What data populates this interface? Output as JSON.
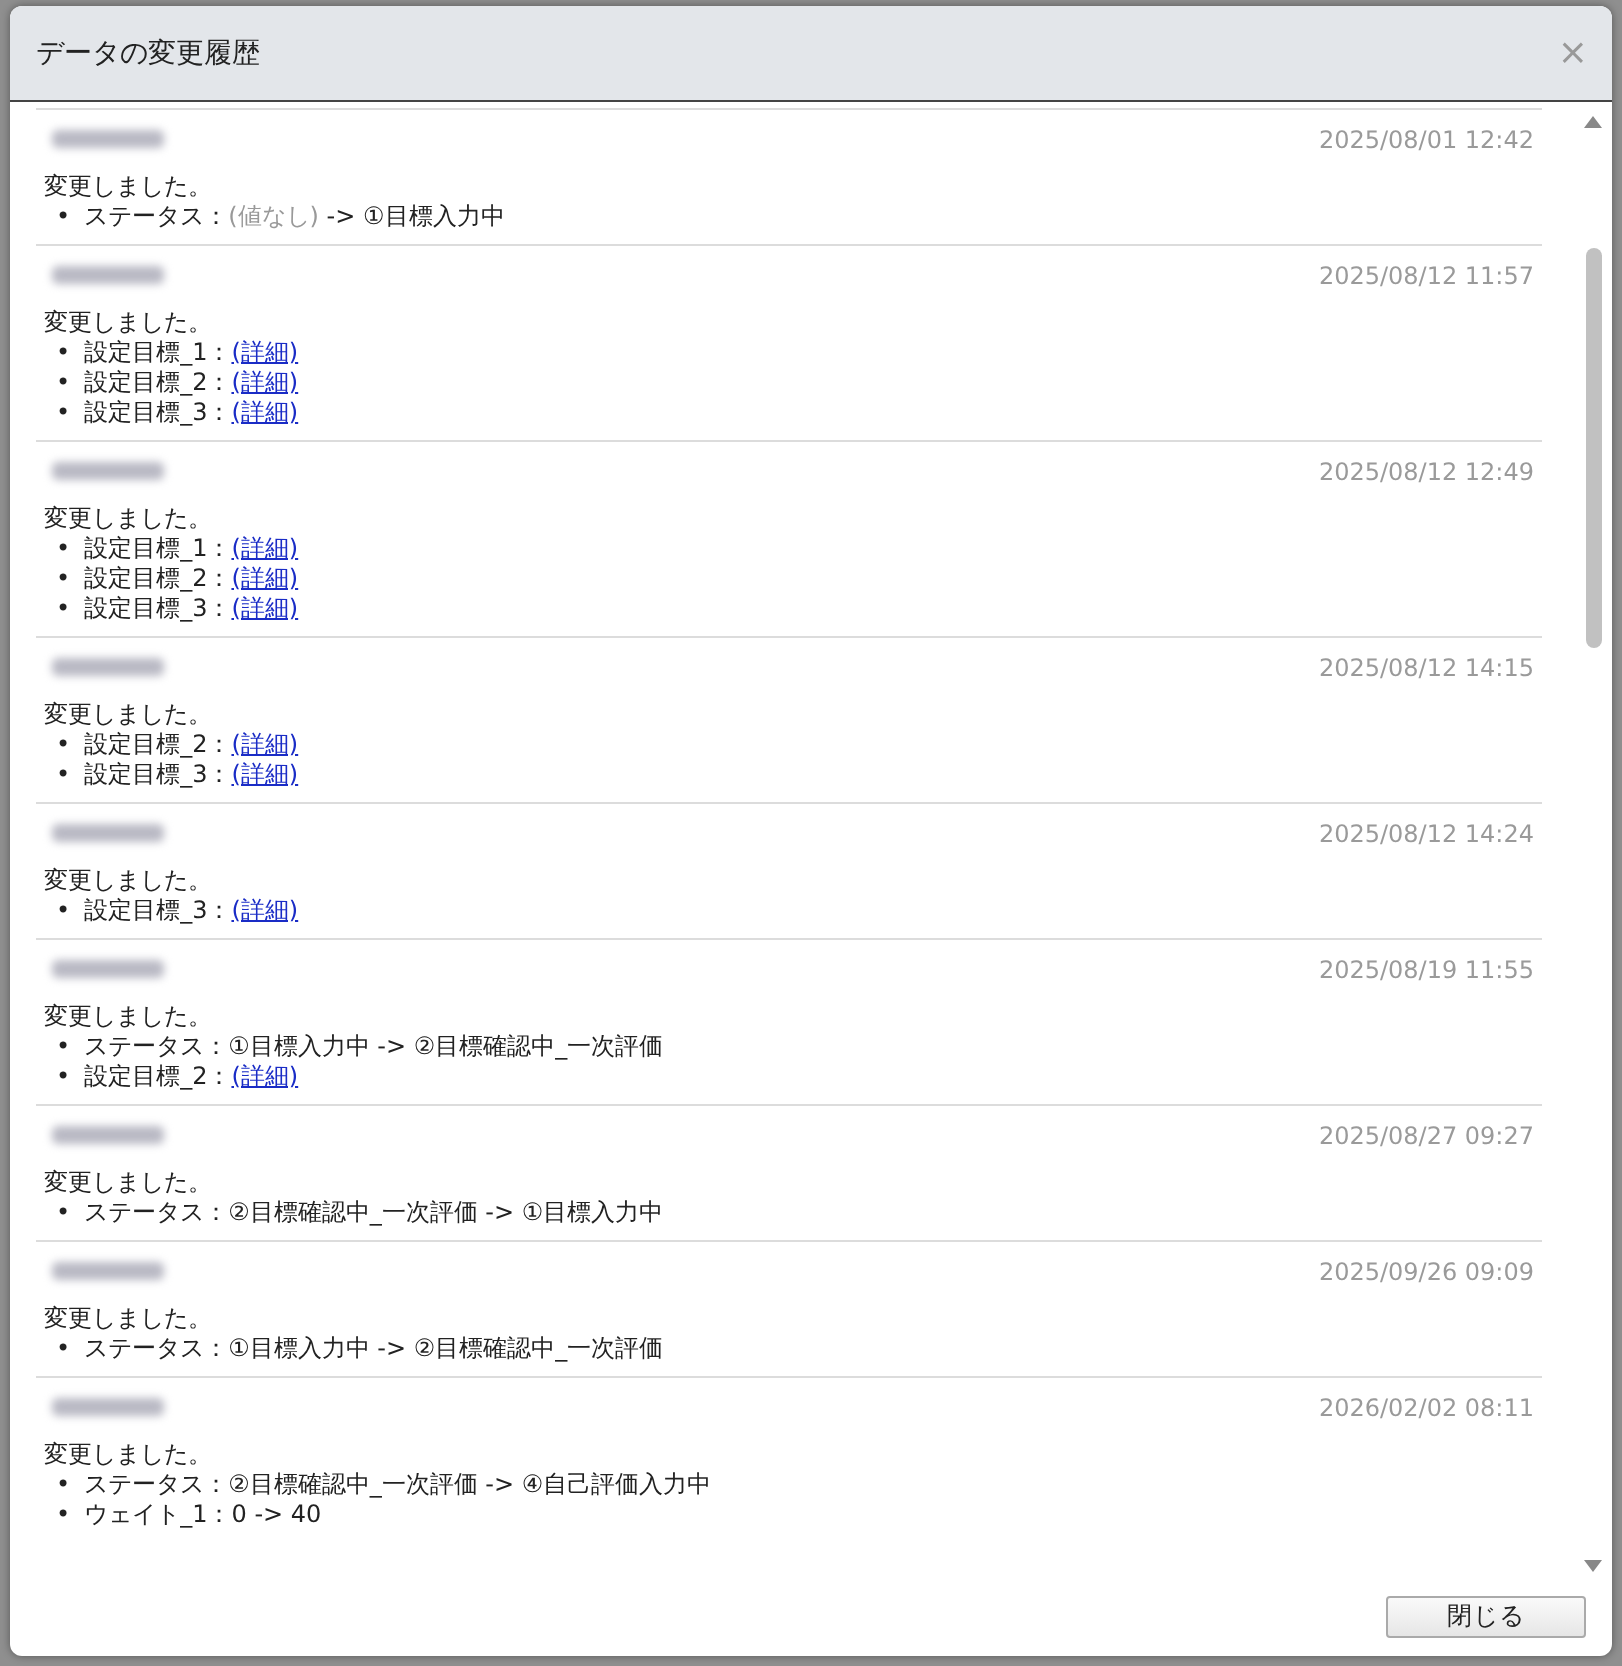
{
  "dialog": {
    "title": "データの変更履歴",
    "close": "×"
  },
  "entries": [
    {
      "date": "2025/08/01 12:42",
      "message": "変更しました。",
      "changes": [
        {
          "kind": "transition",
          "bullet": "•",
          "label": "ステータス：",
          "from": "(値なし)",
          "from_muted": true,
          "arrow": "->",
          "to": "①目標入力中"
        }
      ]
    },
    {
      "date": "2025/08/12 11:57",
      "message": "変更しました。",
      "changes": [
        {
          "kind": "link",
          "bullet": "•",
          "label": "設定目標_1：",
          "link": "(詳細)"
        },
        {
          "kind": "link",
          "bullet": "•",
          "label": "設定目標_2：",
          "link": "(詳細)"
        },
        {
          "kind": "link",
          "bullet": "•",
          "label": "設定目標_3：",
          "link": "(詳細)"
        }
      ]
    },
    {
      "date": "2025/08/12 12:49",
      "message": "変更しました。",
      "changes": [
        {
          "kind": "link",
          "bullet": "•",
          "label": "設定目標_1：",
          "link": "(詳細)"
        },
        {
          "kind": "link",
          "bullet": "•",
          "label": "設定目標_2：",
          "link": "(詳細)"
        },
        {
          "kind": "link",
          "bullet": "•",
          "label": "設定目標_3：",
          "link": "(詳細)"
        }
      ]
    },
    {
      "date": "2025/08/12 14:15",
      "message": "変更しました。",
      "changes": [
        {
          "kind": "link",
          "bullet": "•",
          "label": "設定目標_2：",
          "link": "(詳細)"
        },
        {
          "kind": "link",
          "bullet": "•",
          "label": "設定目標_3：",
          "link": "(詳細)"
        }
      ]
    },
    {
      "date": "2025/08/12 14:24",
      "message": "変更しました。",
      "changes": [
        {
          "kind": "link",
          "bullet": "•",
          "label": "設定目標_3：",
          "link": "(詳細)"
        }
      ]
    },
    {
      "date": "2025/08/19 11:55",
      "message": "変更しました。",
      "changes": [
        {
          "kind": "transition",
          "bullet": "•",
          "label": "ステータス：",
          "from": "①目標入力中",
          "from_muted": false,
          "arrow": "->",
          "to": "②目標確認中_一次評価"
        },
        {
          "kind": "link",
          "bullet": "•",
          "label": "設定目標_2：",
          "link": "(詳細)"
        }
      ]
    },
    {
      "date": "2025/08/27 09:27",
      "message": "変更しました。",
      "changes": [
        {
          "kind": "transition",
          "bullet": "•",
          "label": "ステータス：",
          "from": "②目標確認中_一次評価",
          "from_muted": false,
          "arrow": "->",
          "to": "①目標入力中"
        }
      ]
    },
    {
      "date": "2025/09/26 09:09",
      "message": "変更しました。",
      "changes": [
        {
          "kind": "transition",
          "bullet": "•",
          "label": "ステータス：",
          "from": "①目標入力中",
          "from_muted": false,
          "arrow": "->",
          "to": "②目標確認中_一次評価"
        }
      ]
    },
    {
      "date": "2026/02/02 08:11",
      "message": "変更しました。",
      "changes": [
        {
          "kind": "transition",
          "bullet": "•",
          "label": "ステータス：",
          "from": "②目標確認中_一次評価",
          "from_muted": false,
          "arrow": "->",
          "to": "④自己評価入力中"
        },
        {
          "kind": "transition",
          "bullet": "•",
          "label": "ウェイト_1：",
          "from": "0",
          "from_muted": false,
          "arrow": "->",
          "to": "40"
        }
      ]
    }
  ],
  "footer": {
    "close_button": "閉じる"
  }
}
